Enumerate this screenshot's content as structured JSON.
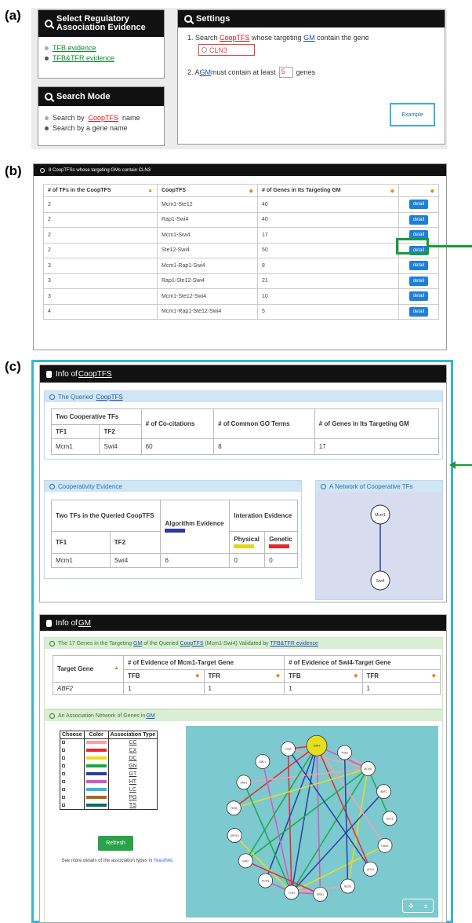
{
  "panels": {
    "a": "(a)",
    "b": "(b)",
    "c": "(c)"
  },
  "evidence_box": {
    "title": "Select Regulatory Association Evidence",
    "options": [
      "TFB evidence",
      "TFB&TFR evidence"
    ],
    "selected": 1
  },
  "search_mode": {
    "title": "Search Mode",
    "opt1_prefix": "Search by ",
    "opt1_link": "CoopTFS",
    "opt1_suffix": " name",
    "opt2": "Search by a gene name"
  },
  "settings": {
    "title": "Settings",
    "line1_a": "1. Search ",
    "line1_link1": "CoopTFS",
    "line1_b": " whose targeting ",
    "line1_link2": "GM",
    "line1_c": " contain the gene",
    "gene_value": "CLN3",
    "line2_a": "2. A ",
    "line2_link": "GM",
    "line2_b": " must contain at least ",
    "min_value": "5",
    "line2_c": " genes",
    "example_button": "Example"
  },
  "results": {
    "header": "8 CoopTFSs whose targeting GMs contain CLN3",
    "columns": [
      "# of TFs in the CoopTFS",
      "CoopTFS",
      "# of Genes in Its Targeting GM",
      ""
    ],
    "detail_label": "detail",
    "rows": [
      [
        "2",
        "Mcm1-Ste12",
        "40"
      ],
      [
        "2",
        "Rap1-Swi4",
        "40"
      ],
      [
        "2",
        "Mcm1-Swi4",
        "17"
      ],
      [
        "2",
        "Ste12-Swi4",
        "50"
      ],
      [
        "3",
        "Mcm1-Rap1-Swi4",
        "8"
      ],
      [
        "3",
        "Rap1-Ste12-Swi4",
        "21"
      ],
      [
        "3",
        "Mcm1-Ste12-Swi4",
        "10"
      ],
      [
        "4",
        "Mcm1-Rap1-Ste12-Swi4",
        "5"
      ]
    ]
  },
  "info_cooptfs": {
    "title_prefix": "Info of ",
    "title_link": "CoopTFS",
    "queried": {
      "head_prefix": "The Queried ",
      "head_link": "CoopTFS",
      "col_two": "Two Cooperative TFs",
      "col_tf1": "TF1",
      "col_tf2": "TF2",
      "col_cocit": "# of Co-citations",
      "col_go": "# of Common GO Terms",
      "col_genes": "# of Genes in Its Targeting GM",
      "row": [
        "Mcm1",
        "Swi4",
        "60",
        "8",
        "17"
      ]
    },
    "coop": {
      "head": "Cooperativity Evidence",
      "col_two": "Two TFs in the Queried CoopTFS",
      "col_tf1": "TF1",
      "col_tf2": "TF2",
      "col_alg": "Algorithm Evidence",
      "col_inter": "Interation Evidence",
      "col_phys": "Physical",
      "col_gen": "Genetic",
      "row": [
        "Mcm1",
        "Swi4",
        "6",
        "0",
        "0"
      ],
      "colors": {
        "algorithm": "#2d3c9c",
        "physical": "#e3d51b",
        "genetic": "#e0282e"
      }
    },
    "network": {
      "head": "A Network of Cooperative TFs",
      "node1": "Mcm1",
      "node2": "Swi4"
    }
  },
  "info_gm": {
    "title_prefix": "Info of ",
    "title_link": "GM",
    "validated": {
      "head_a": "The 17 Genes in the Targeting ",
      "head_link1": "GM",
      "head_b": " of the Queried ",
      "head_link2": "CoopTFS",
      "head_c": " (Mcm1-Swi4) Validated by ",
      "head_link3": "TFB&TFR evidence",
      "col_target": "Target Gene",
      "col_ev1": "# of Evidence of Mcm1-Target Gene",
      "col_ev2": "# of Evidence of Swi4-Target Gene",
      "col_tfb": "TFB",
      "col_tfr": "TFR",
      "row": [
        "ABF2",
        "1",
        "1",
        "1",
        "1"
      ]
    },
    "assoc": {
      "head_a": "An Association Network of Genes in ",
      "head_link": "GM",
      "col_choose": "Choose",
      "col_color": "Color",
      "col_type": "Association Type",
      "types": [
        {
          "code": "CC",
          "color": "#f4a3a8"
        },
        {
          "code": "CX",
          "color": "#e8282e"
        },
        {
          "code": "DC",
          "color": "#e7df1e"
        },
        {
          "code": "GN",
          "color": "#1aa84a"
        },
        {
          "code": "GT",
          "color": "#2d3fa0"
        },
        {
          "code": "HT",
          "color": "#d756c0"
        },
        {
          "code": "LC",
          "color": "#39b4d6"
        },
        {
          "code": "PG",
          "color": "#a56a1e"
        },
        {
          "code": "TS",
          "color": "#0d6e68"
        }
      ],
      "refresh": "Refresh",
      "note_a": "See more details of the association types in ",
      "note_link": "YeastNet",
      "nodes": [
        "CLB2",
        "SWI4",
        "TNS1",
        "MCM1",
        "ABF2",
        "RLK1",
        "DAN1",
        "ALD4",
        "BLD3",
        "SRN1",
        "CLB1",
        "CDC5",
        "SIR2",
        "ASP10",
        "YDS1",
        "SAS1",
        "DBL1"
      ]
    }
  }
}
